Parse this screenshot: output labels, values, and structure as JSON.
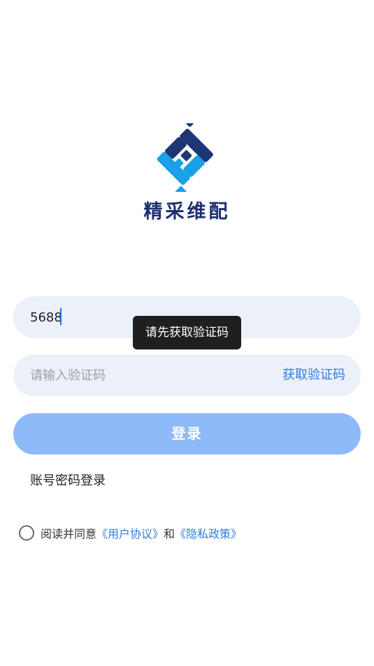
{
  "brand": {
    "name": "精采维配",
    "logo_icon": "interlocking-diamond-logo",
    "colors": {
      "navy": "#1d3676",
      "sky": "#1aa0e6",
      "accent": "#2f7de1"
    }
  },
  "phone": {
    "value": "5688"
  },
  "toast": {
    "text": "请先获取验证码"
  },
  "code": {
    "placeholder": "请输入验证码",
    "get_code_label": "获取验证码"
  },
  "login": {
    "label": "登录",
    "color": "#8fbaf9"
  },
  "alt_login": {
    "label": "账号密码登录"
  },
  "agreement": {
    "checked": false,
    "prefix": "阅读并同意",
    "user_agreement": "《用户协议》",
    "and": "和",
    "privacy_policy": "《隐私政策》"
  }
}
